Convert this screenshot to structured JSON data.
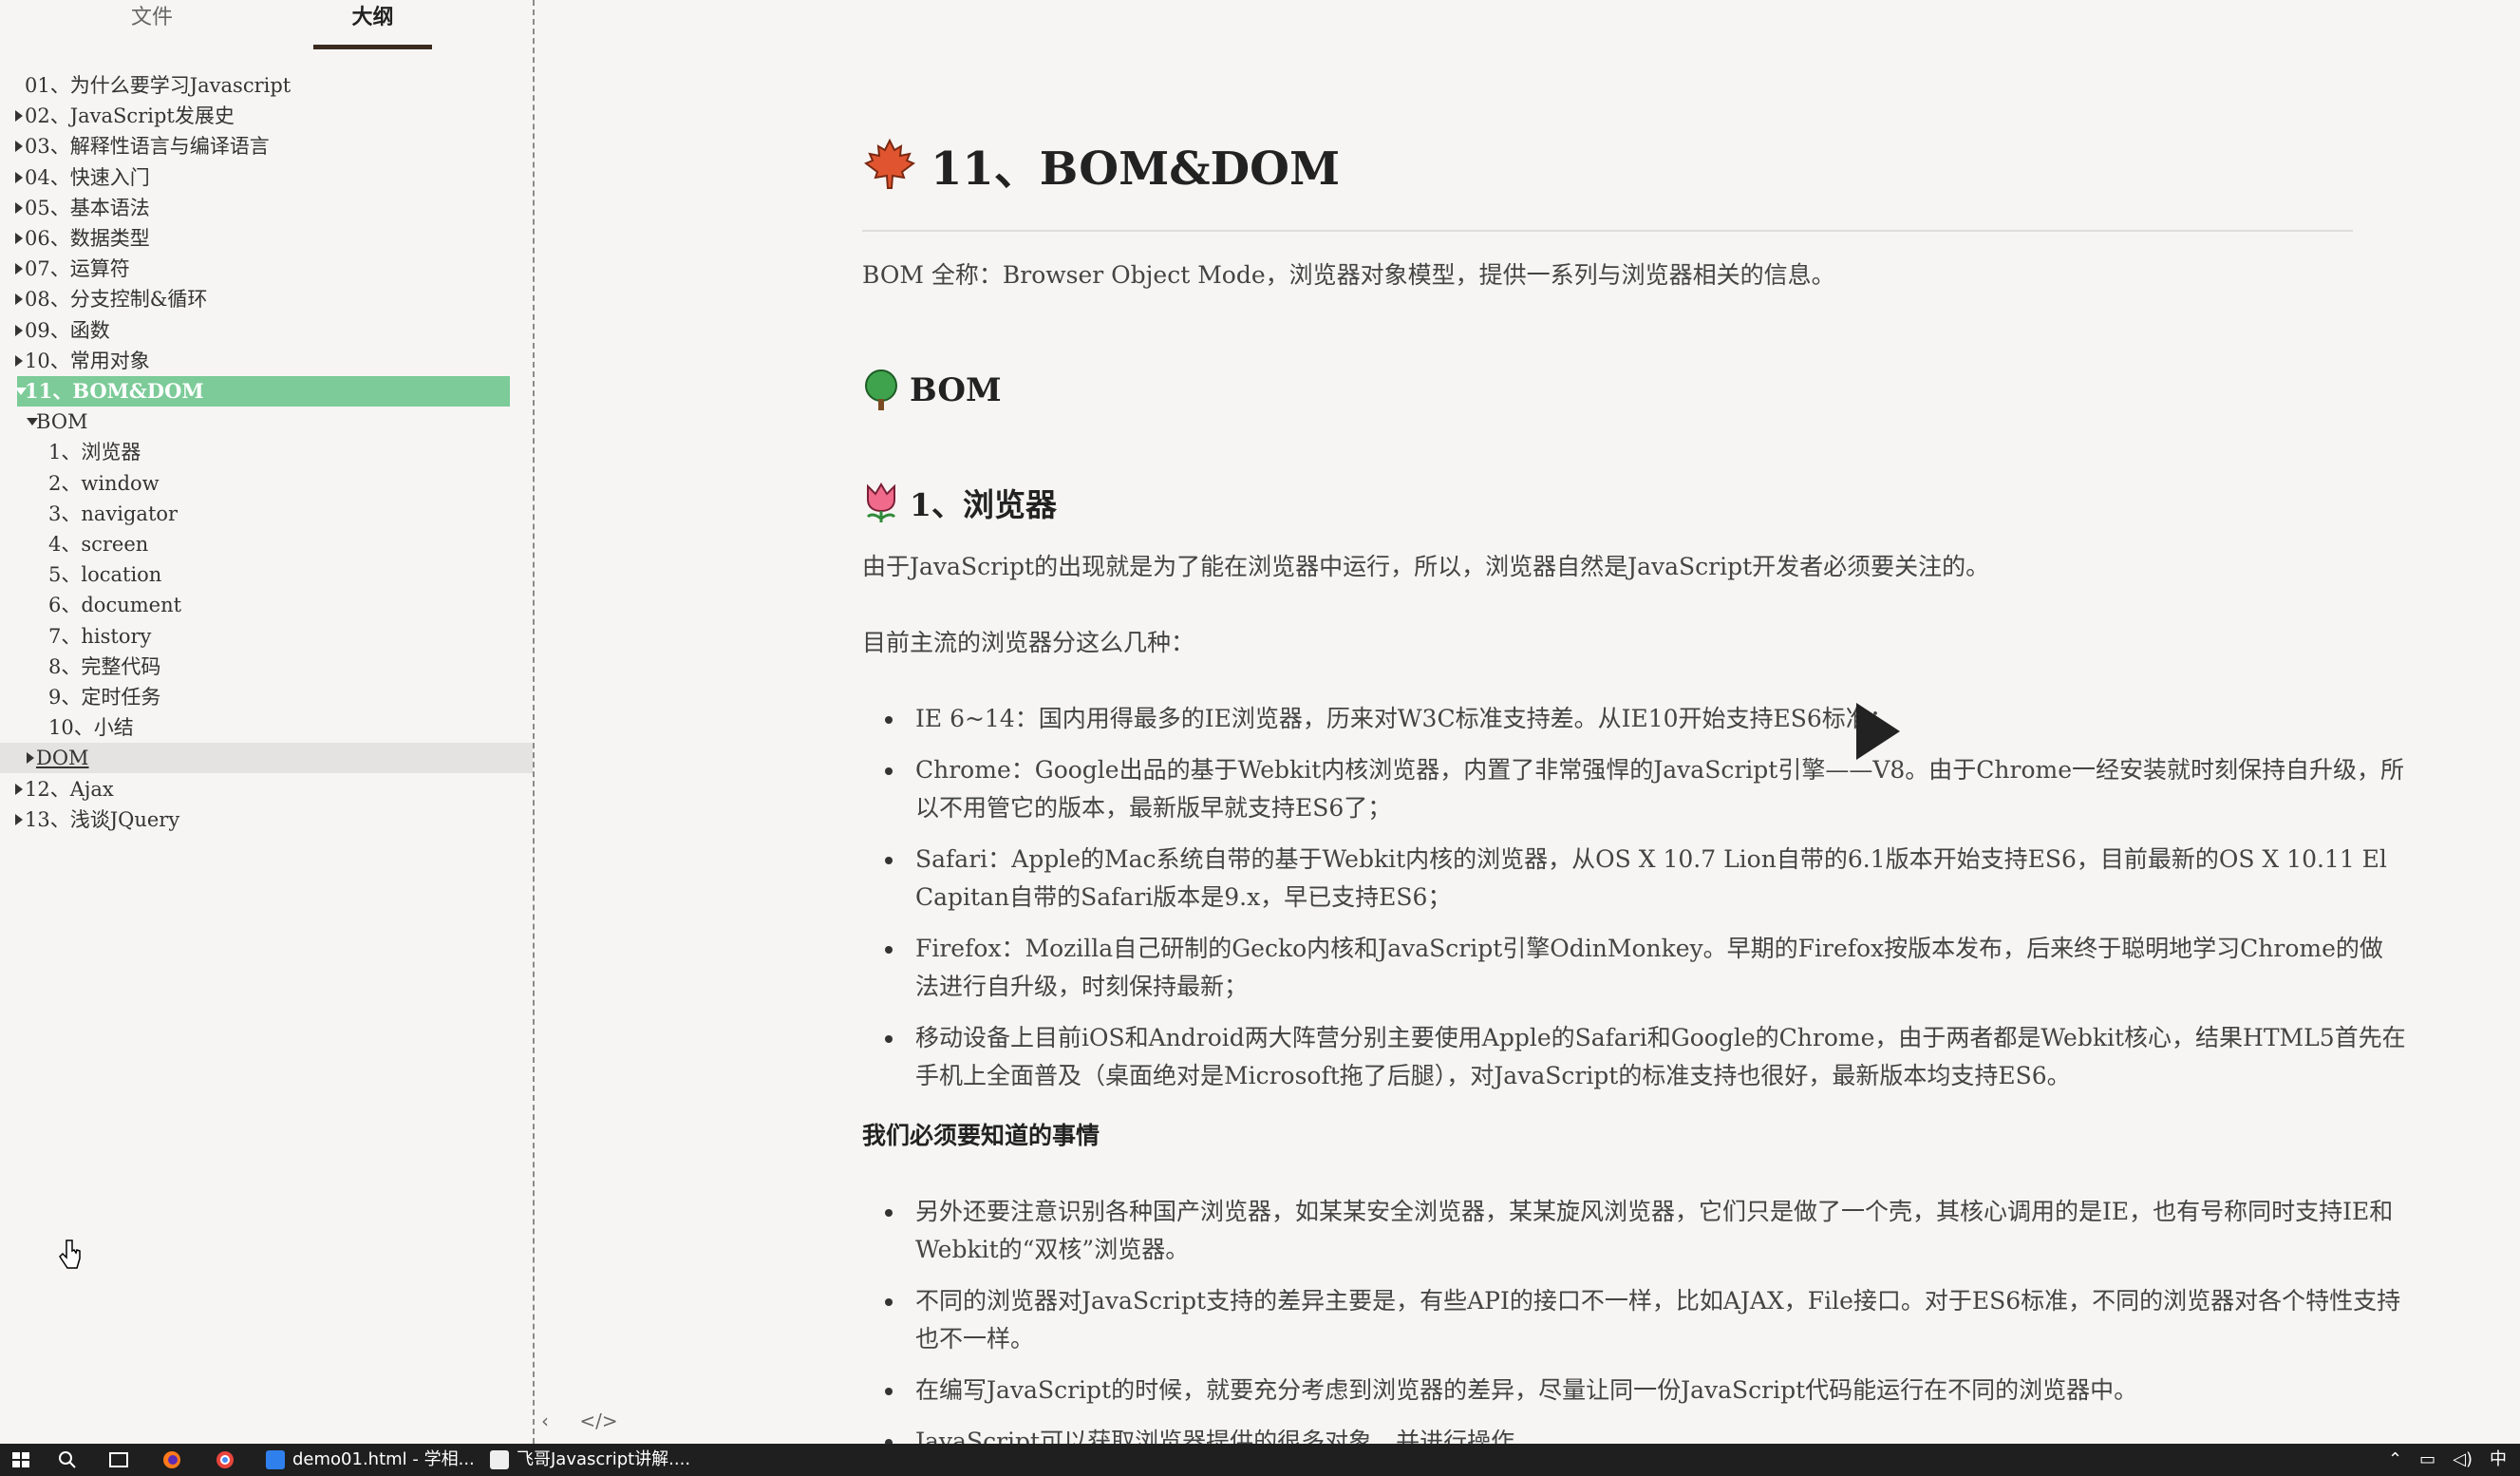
{
  "sidebar": {
    "tabs": {
      "files": "文件",
      "outline": "大纲"
    },
    "items": [
      {
        "label": "01、为什么要学习Javascript",
        "expander": "none",
        "indent": 0
      },
      {
        "label": "02、JavaScript发展史",
        "expander": "collapsed",
        "indent": 0
      },
      {
        "label": "03、解释性语言与编译语言",
        "expander": "collapsed",
        "indent": 0
      },
      {
        "label": "04、快速入门",
        "expander": "collapsed",
        "indent": 0
      },
      {
        "label": "05、基本语法",
        "expander": "collapsed",
        "indent": 0
      },
      {
        "label": "06、数据类型",
        "expander": "collapsed",
        "indent": 0
      },
      {
        "label": "07、运算符",
        "expander": "collapsed",
        "indent": 0
      },
      {
        "label": "08、分支控制&循环",
        "expander": "collapsed",
        "indent": 0
      },
      {
        "label": "09、函数",
        "expander": "collapsed",
        "indent": 0
      },
      {
        "label": "10、常用对象",
        "expander": "collapsed",
        "indent": 0
      },
      {
        "label": "11、BOM&DOM",
        "expander": "expanded",
        "indent": 0,
        "state": "active"
      },
      {
        "label": "BOM",
        "expander": "expanded",
        "indent": 1
      },
      {
        "label": "1、浏览器",
        "expander": "none",
        "indent": 2
      },
      {
        "label": "2、window",
        "expander": "none",
        "indent": 2
      },
      {
        "label": "3、navigator",
        "expander": "none",
        "indent": 2
      },
      {
        "label": "4、screen",
        "expander": "none",
        "indent": 2
      },
      {
        "label": "5、location",
        "expander": "none",
        "indent": 2
      },
      {
        "label": "6、document",
        "expander": "none",
        "indent": 2
      },
      {
        "label": "7、history",
        "expander": "none",
        "indent": 2
      },
      {
        "label": "8、完整代码",
        "expander": "none",
        "indent": 2
      },
      {
        "label": "9、定时任务",
        "expander": "none",
        "indent": 2
      },
      {
        "label": "10、小结",
        "expander": "none",
        "indent": 2
      },
      {
        "label": "DOM",
        "expander": "collapsed",
        "indent": 1,
        "state": "hover"
      },
      {
        "label": "12、Ajax",
        "expander": "collapsed",
        "indent": 0
      },
      {
        "label": "13、浅谈JQuery",
        "expander": "collapsed",
        "indent": 0
      }
    ],
    "footer": {
      "collapse_glyph": "‹",
      "source_glyph": "</>"
    }
  },
  "content": {
    "h1": {
      "icon": "maple-leaf-icon",
      "text": "11、BOM&DOM"
    },
    "intro": "BOM 全称：Browser Object Mode，浏览器对象模型，提供一系列与浏览器相关的信息。",
    "h2": {
      "icon": "tree-icon",
      "text": "BOM"
    },
    "h3": {
      "icon": "tulip-icon",
      "text": "1、浏览器"
    },
    "p1": "由于JavaScript的出现就是为了能在浏览器中运行，所以，浏览器自然是JavaScript开发者必须要关注的。",
    "p2": "目前主流的浏览器分这么几种：",
    "browsers": [
      "IE 6~14：国内用得最多的IE浏览器，历来对W3C标准支持差。从IE10开始支持ES6标准；",
      "Chrome：Google出品的基于Webkit内核浏览器，内置了非常强悍的JavaScript引擎——V8。由于Chrome一经安装就时刻保持自升级，所以不用管它的版本，最新版早就支持ES6了；",
      "Safari：Apple的Mac系统自带的基于Webkit内核的浏览器，从OS X 10.7 Lion自带的6.1版本开始支持ES6，目前最新的OS X 10.11 El Capitan自带的Safari版本是9.x，早已支持ES6；",
      "Firefox：Mozilla自己研制的Gecko内核和JavaScript引擎OdinMonkey。早期的Firefox按版本发布，后来终于聪明地学习Chrome的做法进行自升级，时刻保持最新；",
      "移动设备上目前iOS和Android两大阵营分别主要使用Apple的Safari和Google的Chrome，由于两者都是Webkit核心，结果HTML5首先在手机上全面普及（桌面绝对是Microsoft拖了后腿），对JavaScript的标准支持也很好，最新版本均支持ES6。"
    ],
    "must_know_heading": "我们必须要知道的事情",
    "must_know": [
      "另外还要注意识别各种国产浏览器，如某某安全浏览器，某某旋风浏览器，它们只是做了一个壳，其核心调用的是IE，也有号称同时支持IE和Webkit的“双核”浏览器。",
      "不同的浏览器对JavaScript支持的差异主要是，有些API的接口不一样，比如AJAX，File接口。对于ES6标准，不同的浏览器对各个特性支持也不一样。",
      "在编写JavaScript的时候，就要充分考虑到浏览器的差异，尽量让同一份JavaScript代码能运行在不同的浏览器中。",
      "JavaScript可以获取浏览器提供的很多对象，并进行操作。"
    ]
  },
  "taskbar": {
    "apps": [
      {
        "icon": "vscode-icon",
        "label": "demo01.html - 学相..."
      },
      {
        "icon": "typora-icon",
        "label": "飞哥Javascript讲解...."
      }
    ],
    "tray_ime": "中"
  },
  "colors": {
    "active_item": "#7ccb98",
    "taskbar": "#1f1f1f",
    "background": "#f6f5f3"
  }
}
